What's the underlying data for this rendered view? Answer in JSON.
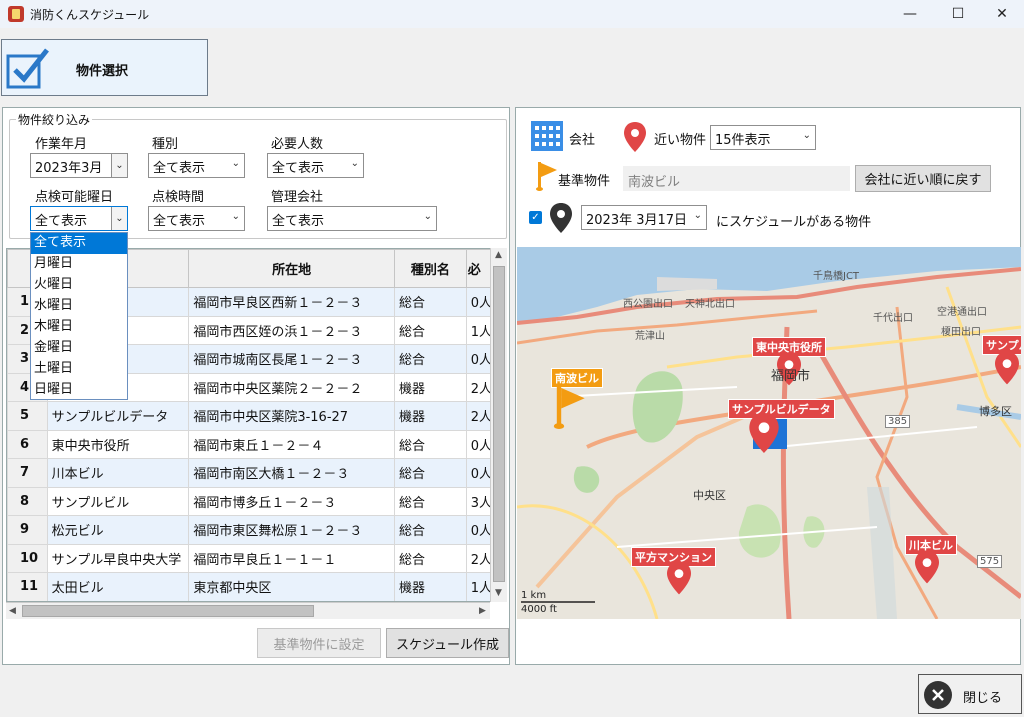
{
  "window": {
    "title": "消防くんスケジュール",
    "min": "—",
    "max": "☐",
    "close": "✕"
  },
  "toolbar": {
    "select_label": "物件選択"
  },
  "filter": {
    "group_title": "物件絞り込み",
    "work_month_label": "作業年月",
    "work_month_value": "2023年3月",
    "type_label": "種別",
    "type_value": "全て表示",
    "people_label": "必要人数",
    "people_value": "全て表示",
    "weekday_label": "点検可能曜日",
    "weekday_value": "全て表示",
    "time_label": "点検時間",
    "time_value": "全て表示",
    "company_label": "管理会社",
    "company_value": "全て表示"
  },
  "weekday_options": [
    "全て表示",
    "月曜日",
    "火曜日",
    "水曜日",
    "木曜日",
    "金曜日",
    "土曜日",
    "日曜日"
  ],
  "table": {
    "headers": [
      "",
      "名",
      "所在地",
      "種別名",
      "必"
    ],
    "rows": [
      {
        "no": "1",
        "name": "",
        "address": "福岡市早良区西新１－２－３",
        "type": "総合",
        "people": "0人"
      },
      {
        "no": "2",
        "name": "",
        "address": "福岡市西区姪の浜１－２－３",
        "type": "総合",
        "people": "1人"
      },
      {
        "no": "3",
        "name": "ィ",
        "address": "福岡市城南区長尾１－２－３",
        "type": "総合",
        "people": "0人"
      },
      {
        "no": "4",
        "name": "",
        "address": "福岡市中央区薬院２－２－２",
        "type": "機器",
        "people": "2人"
      },
      {
        "no": "5",
        "name": "サンプルビルデータ",
        "address": "福岡市中央区薬院3-16-27",
        "type": "機器",
        "people": "2人"
      },
      {
        "no": "6",
        "name": "東中央市役所",
        "address": "福岡市東丘１－２－４",
        "type": "総合",
        "people": "0人"
      },
      {
        "no": "7",
        "name": "川本ビル",
        "address": "福岡市南区大橋１－２－３",
        "type": "総合",
        "people": "0人"
      },
      {
        "no": "8",
        "name": "サンプルビル",
        "address": "福岡市博多丘１－２－３",
        "type": "総合",
        "people": "3人"
      },
      {
        "no": "9",
        "name": "松元ビル",
        "address": "福岡市東区舞松原１－２－３",
        "type": "総合",
        "people": "0人"
      },
      {
        "no": "10",
        "name": "サンプル早良中央大学",
        "address": "福岡市早良丘１－１－１",
        "type": "総合",
        "people": "2人"
      },
      {
        "no": "11",
        "name": "太田ビル",
        "address": "東京都中央区",
        "type": "機器",
        "people": "1人"
      }
    ]
  },
  "buttons": {
    "set_base": "基準物件に設定",
    "create_schedule": "スケジュール作成",
    "close": "閉じる",
    "reset_order": "会社に近い順に戻す"
  },
  "right": {
    "company_label": "会社",
    "nearby_label": "近い物件",
    "nearby_value": "15件表示",
    "base_label": "基準物件",
    "base_value": "南波ビル",
    "date_value": "2023年  3月17日",
    "schedule_suffix": "にスケジュールがある物件"
  },
  "map": {
    "markers": [
      "東中央市役所",
      "南波ビル",
      "サンプルビルデータ",
      "平方マンション",
      "川本ビル",
      "サンプル"
    ],
    "labels": [
      "福岡市",
      "中央区",
      "博多区",
      "西公園出口",
      "天神北出口",
      "荒津山",
      "千鳥橋JCT",
      "空港通出口",
      "千代出口",
      "榎田出口",
      "1 km",
      "4000 ft",
      "575",
      "385"
    ]
  },
  "colors": {
    "accent": "#0078d7",
    "marker_red": "#e04646",
    "marker_orange": "#f39c12",
    "sea": "#a9cbe6"
  }
}
